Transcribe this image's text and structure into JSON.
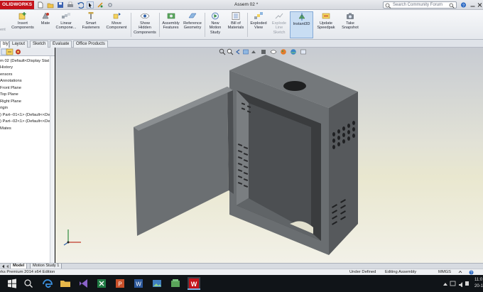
{
  "app": {
    "logo_text": "OLIDWORKS",
    "document_title": "Assem 02 *",
    "search_placeholder": "Search Community Forum"
  },
  "ribbon": {
    "ghost_label": "ent",
    "buttons": [
      {
        "id": "insert-components",
        "label1": "Insert",
        "label2": "Components",
        "icon": "insert-components-icon"
      },
      {
        "id": "mate",
        "label1": "Mate",
        "label2": "",
        "icon": "mate-icon"
      },
      {
        "id": "linear-component-pattern",
        "label1": "Linear",
        "label2": "Compone...",
        "icon": "linear-pattern-icon"
      },
      {
        "id": "smart-fasteners",
        "label1": "Smart",
        "label2": "Fasteners",
        "icon": "smart-fasteners-icon"
      },
      {
        "id": "move-component",
        "label1": "Move",
        "label2": "Component",
        "icon": "move-component-icon"
      },
      {
        "id": "show-hidden-components",
        "label1": "Show",
        "label2": "Hidden",
        "label3": "Components",
        "icon": "show-hidden-icon"
      },
      {
        "id": "assembly-features",
        "label1": "Assembly",
        "label2": "Features",
        "icon": "assembly-features-icon"
      },
      {
        "id": "reference-geometry",
        "label1": "Reference",
        "label2": "Geometry",
        "icon": "reference-geometry-icon"
      },
      {
        "id": "new-motion-study",
        "label1": "New",
        "label2": "Motion",
        "label3": "Study",
        "icon": "motion-study-icon"
      },
      {
        "id": "bill-of-materials",
        "label1": "Bill of",
        "label2": "Materials",
        "icon": "bom-icon"
      },
      {
        "id": "exploded-view",
        "label1": "Exploded",
        "label2": "View",
        "icon": "exploded-view-icon"
      },
      {
        "id": "explode-line-sketch",
        "label1": "Explode",
        "label2": "Line",
        "label3": "Sketch",
        "icon": "explode-line-sketch-icon",
        "disabled": true
      },
      {
        "id": "instant3d",
        "label1": "Instant3D",
        "label2": "",
        "icon": "instant3d-icon",
        "active": true
      },
      {
        "id": "update-speedpak",
        "label1": "Update",
        "label2": "Speedpak",
        "icon": "speedpak-icon"
      },
      {
        "id": "take-snapshot",
        "label1": "Take",
        "label2": "Snapshot",
        "icon": "snapshot-icon"
      }
    ]
  },
  "tabs": [
    "bly",
    "Layout",
    "Sketch",
    "Evaluate",
    "Office Products"
  ],
  "feature_tree": {
    "items": [
      "m 02  (Default<Display Stat",
      "History",
      "ensors",
      "Annotations",
      "Front Plane",
      "Top Plane",
      "Right Plane",
      "rigin",
      ") Part--01<1> (Default<<De",
      ") Part--02<1> (Default<<De",
      "Mates"
    ]
  },
  "bottom_tabs": [
    "Model",
    "Motion Study 1"
  ],
  "status": {
    "edition": "rks Premium 2014 x64 Edition",
    "definition": "Under Defined",
    "mode": "Editing Assembly",
    "units": "MMGS"
  },
  "taskbar": {
    "time": "11:0",
    "date": "20-1",
    "icons": [
      "windows-start-icon",
      "search-icon",
      "task-view-icon",
      "edge-browser-icon",
      "file-explorer-icon",
      "store-icon",
      "visual-studio-icon",
      "excel-icon",
      "powerpoint-icon",
      "paint-icon",
      "word-icon",
      "photos-icon",
      "folder-icon",
      "solidworks-icon"
    ]
  },
  "colors": {
    "brand_red": "#c4121a",
    "model_gray": "#5f6366",
    "active_blue": "#c8ddf3"
  }
}
